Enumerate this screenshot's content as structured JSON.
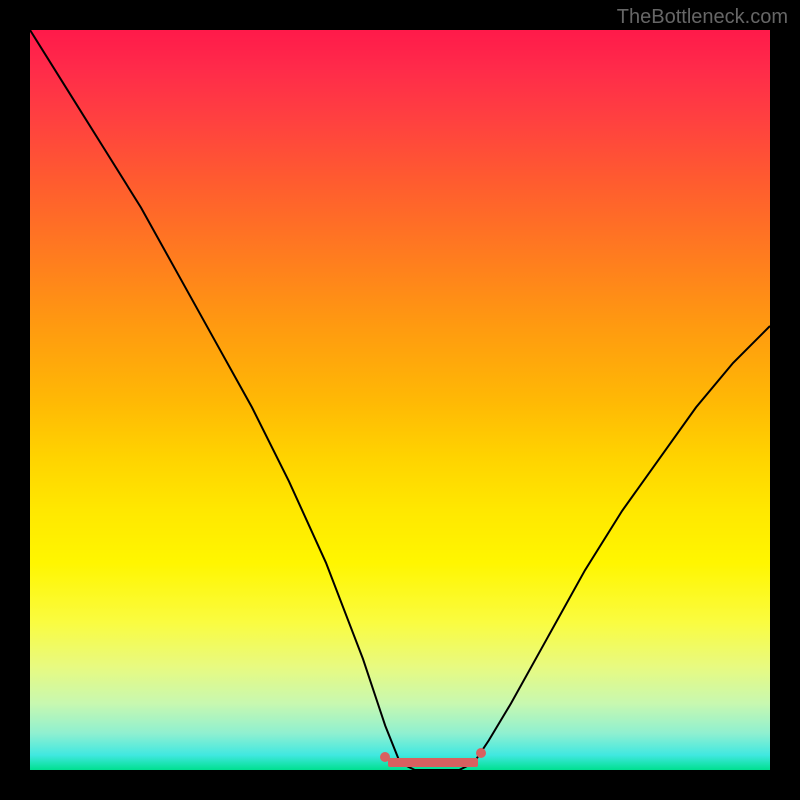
{
  "watermark": "TheBottleneck.com",
  "chart_data": {
    "type": "line",
    "title": "",
    "xlabel": "",
    "ylabel": "",
    "xlim": [
      0,
      100
    ],
    "ylim": [
      0,
      100
    ],
    "series": [
      {
        "name": "curve",
        "x": [
          0,
          5,
          10,
          15,
          20,
          25,
          30,
          35,
          40,
          45,
          48,
          50,
          52,
          55,
          58,
          60,
          62,
          65,
          70,
          75,
          80,
          85,
          90,
          95,
          100
        ],
        "y": [
          100,
          92,
          84,
          76,
          67,
          58,
          49,
          39,
          28,
          15,
          6,
          1,
          0,
          0,
          0,
          1,
          4,
          9,
          18,
          27,
          35,
          42,
          49,
          55,
          60
        ]
      }
    ],
    "annotations": [
      {
        "kind": "marker-segment",
        "x_start": 48,
        "x_end": 62,
        "color": "#d86060"
      }
    ],
    "background": {
      "type": "vertical-gradient",
      "stops": [
        {
          "pos": 0.0,
          "color": "#ff1a4a"
        },
        {
          "pos": 0.5,
          "color": "#ffb805"
        },
        {
          "pos": 0.75,
          "color": "#fff600"
        },
        {
          "pos": 1.0,
          "color": "#00e090"
        }
      ]
    }
  }
}
